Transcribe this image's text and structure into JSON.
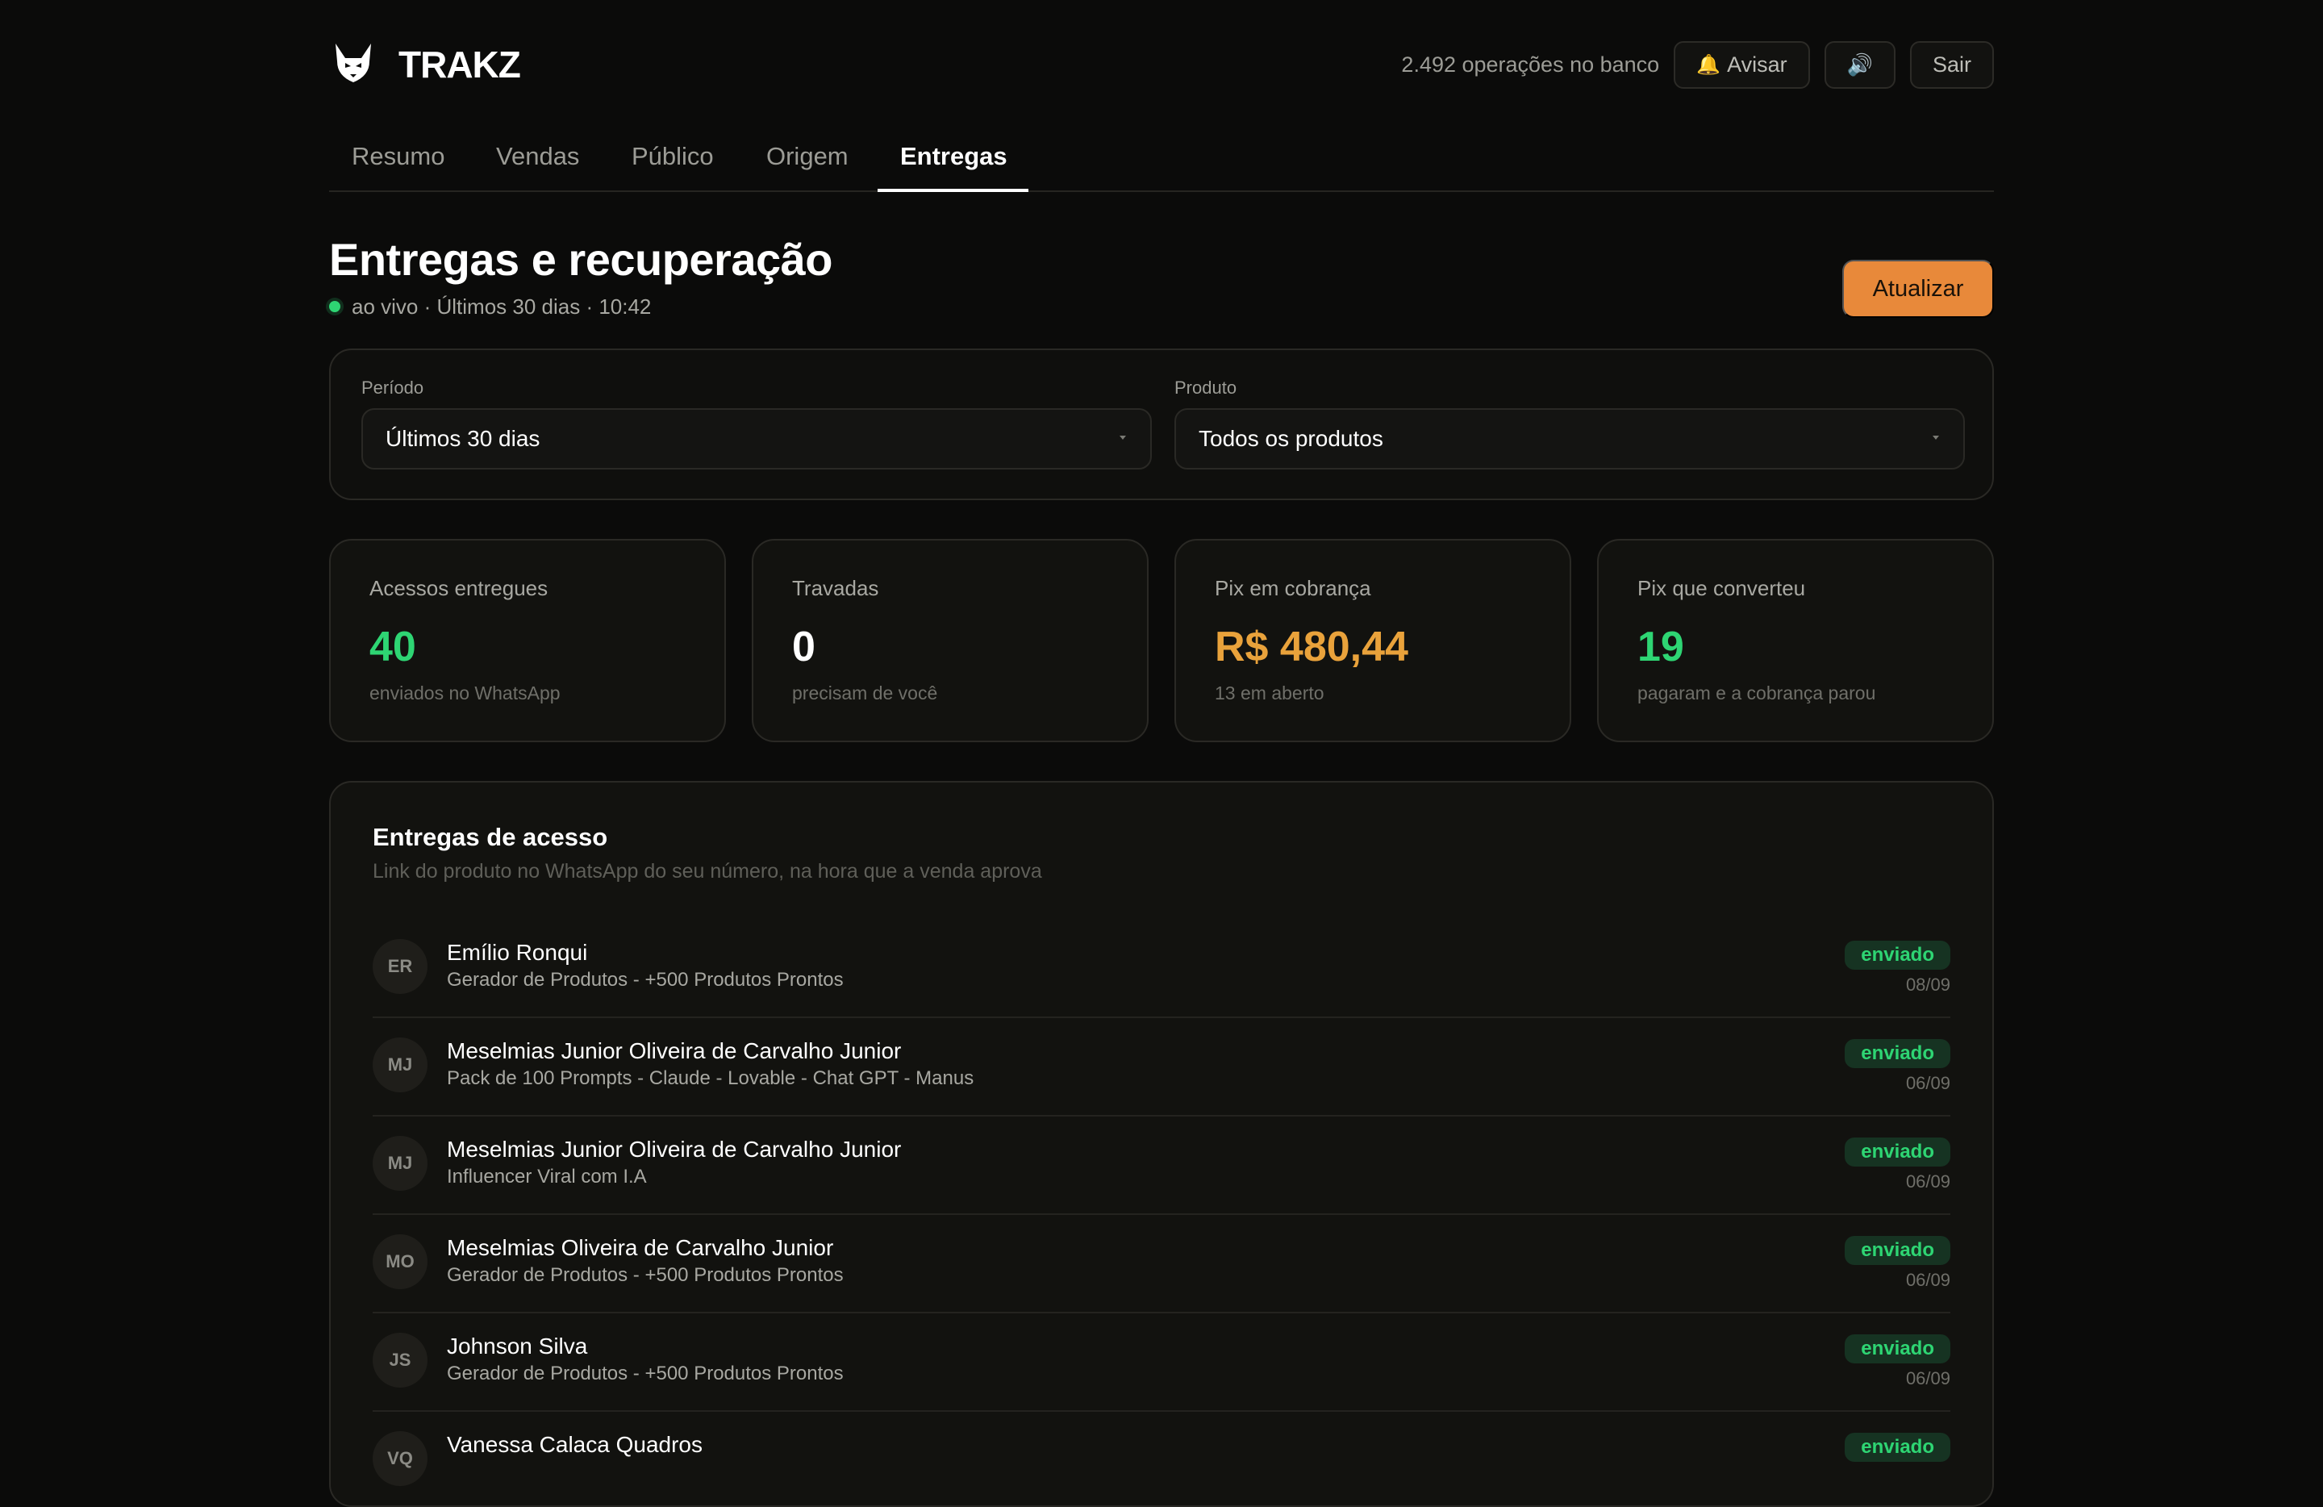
{
  "header": {
    "brand": "TRAKZ",
    "operations": "2.492 operações no banco",
    "notify_label": "Avisar",
    "sound_label": "🔊",
    "logout_label": "Sair"
  },
  "tabs": [
    {
      "label": "Resumo"
    },
    {
      "label": "Vendas"
    },
    {
      "label": "Público"
    },
    {
      "label": "Origem"
    },
    {
      "label": "Entregas"
    }
  ],
  "page": {
    "title": "Entregas e recuperação",
    "status": "ao vivo · Últimos 30 dias · 10:42",
    "refresh_label": "Atualizar"
  },
  "filters": {
    "period_label": "Período",
    "period_value": "Últimos 30 dias",
    "product_label": "Produto",
    "product_value": "Todos os produtos"
  },
  "stats": [
    {
      "label": "Acessos entregues",
      "value": "40",
      "sub": "enviados no WhatsApp"
    },
    {
      "label": "Travadas",
      "value": "0",
      "sub": "precisam de você"
    },
    {
      "label": "Pix em cobrança",
      "value": "R$ 480,44",
      "sub": "13 em aberto"
    },
    {
      "label": "Pix que converteu",
      "value": "19",
      "sub": "pagaram e a cobrança parou"
    }
  ],
  "deliveries": {
    "title": "Entregas de acesso",
    "subtitle": "Link do produto no WhatsApp do seu número, na hora que a venda aprova",
    "items": [
      {
        "initials": "ER",
        "name": "Emílio Ronqui",
        "product": "Gerador de Produtos - +500 Produtos Prontos",
        "status": "enviado",
        "date": "08/09"
      },
      {
        "initials": "MJ",
        "name": "Meselmias Junior Oliveira de Carvalho Junior",
        "product": "Pack de 100 Prompts - Claude - Lovable - Chat GPT - Manus",
        "status": "enviado",
        "date": "06/09"
      },
      {
        "initials": "MJ",
        "name": "Meselmias Junior Oliveira de Carvalho Junior",
        "product": "Influencer Viral com I.A",
        "status": "enviado",
        "date": "06/09"
      },
      {
        "initials": "MO",
        "name": "Meselmias Oliveira de Carvalho Junior",
        "product": "Gerador de Produtos - +500 Produtos Prontos",
        "status": "enviado",
        "date": "06/09"
      },
      {
        "initials": "JS",
        "name": "Johnson Silva",
        "product": "Gerador de Produtos - +500 Produtos Prontos",
        "status": "enviado",
        "date": "06/09"
      },
      {
        "initials": "VQ",
        "name": "Vanessa Calaca Quadros",
        "product": "",
        "status": "enviado",
        "date": ""
      }
    ]
  }
}
